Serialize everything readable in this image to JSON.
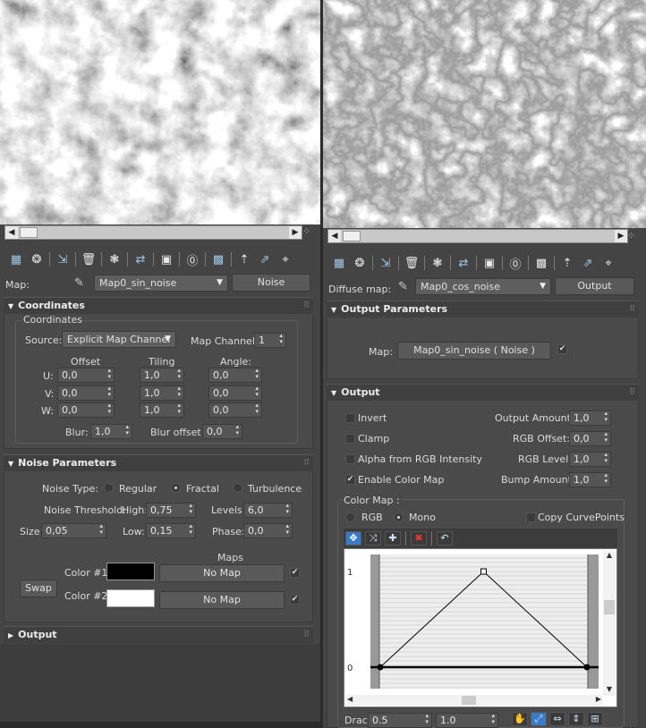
{
  "left": {
    "toolbar_icons": [
      "get-material-icon",
      "put-to-scene-icon",
      "assign-material-icon",
      "delete-icon",
      "make-unique-icon",
      "put-to-library-icon",
      "save-icon",
      "material-id-icon",
      "show-in-viewport-icon",
      "go-to-parent-icon",
      "go-forward-icon",
      "pick-material-icon"
    ],
    "map_label": "Map:",
    "map_name": "Map0_sin_noise",
    "map_type": "Noise",
    "coordinates": {
      "rollout": "Coordinates",
      "group": "Coordinates",
      "source_label": "Source:",
      "source_value": "Explicit Map Channel",
      "map_channel_label": "Map Channel:",
      "map_channel_value": "1",
      "col_offset": "Offset",
      "col_tiling": "Tiling",
      "col_angle": "Angle:",
      "rows": [
        {
          "label": "U:",
          "offset": "0,0",
          "tiling": "1,0",
          "angle": "0,0"
        },
        {
          "label": "V:",
          "offset": "0,0",
          "tiling": "1,0",
          "angle": "0,0"
        },
        {
          "label": "W:",
          "offset": "0,0",
          "tiling": "1,0",
          "angle": "0,0"
        }
      ],
      "blur_label": "Blur:",
      "blur_value": "1,0",
      "blur_offset_label": "Blur offset:",
      "blur_offset_value": "0,0"
    },
    "noise": {
      "rollout": "Noise Parameters",
      "type_label": "Noise Type:",
      "types": [
        "Regular",
        "Fractal",
        "Turbulence"
      ],
      "selected_type": "Fractal",
      "threshold_label": "Noise Threshold:",
      "high_label": "High:",
      "high_value": "0,75",
      "levels_label": "Levels:",
      "levels_value": "6,0",
      "size_label": "Size:",
      "size_value": "0,05",
      "low_label": "Low:",
      "low_value": "0,15",
      "phase_label": "Phase:",
      "phase_value": "0,0",
      "maps_label": "Maps",
      "swap_label": "Swap",
      "color1_label": "Color #1",
      "color1": "#000000",
      "color2_label": "Color #2",
      "color2": "#ffffff",
      "no_map": "No Map"
    },
    "output_rollout": "Output"
  },
  "right": {
    "toolbar_icons": [
      "get-material-icon",
      "put-to-scene-icon",
      "assign-material-icon",
      "delete-icon",
      "make-unique-icon",
      "put-to-library-icon",
      "save-icon",
      "material-id-icon",
      "show-in-viewport-icon",
      "go-to-parent-icon",
      "go-forward-icon",
      "pick-material-icon"
    ],
    "map_label": "Diffuse map:",
    "map_name": "Map0_cos_noise",
    "map_type": "Output",
    "output_parameters": {
      "rollout": "Output Parameters",
      "map_label": "Map:",
      "map_value": "Map0_sin_noise  ( Noise )"
    },
    "output": {
      "rollout": "Output",
      "invert": "Invert",
      "clamp": "Clamp",
      "alpha": "Alpha from RGB Intensity",
      "enable_color_map": "Enable Color Map",
      "output_amount_label": "Output Amount:",
      "output_amount": "1,0",
      "rgb_offset_label": "RGB Offset:",
      "rgb_offset": "0,0",
      "rgb_level_label": "RGB Level:",
      "rgb_level": "1,0",
      "bump_amount_label": "Bump Amount:",
      "bump_amount": "1,0"
    },
    "color_map": {
      "label": "Color Map :",
      "rgb": "RGB",
      "mono": "Mono",
      "copy_curve_points": "Copy CurvePoints",
      "tick_top": "1",
      "tick_bottom": "0",
      "points": [
        [
          0,
          0
        ],
        [
          0.5,
          1
        ],
        [
          1,
          0
        ]
      ],
      "drag_label": "Drac",
      "drag_x": "0.5",
      "drag_y": "1.0"
    }
  }
}
